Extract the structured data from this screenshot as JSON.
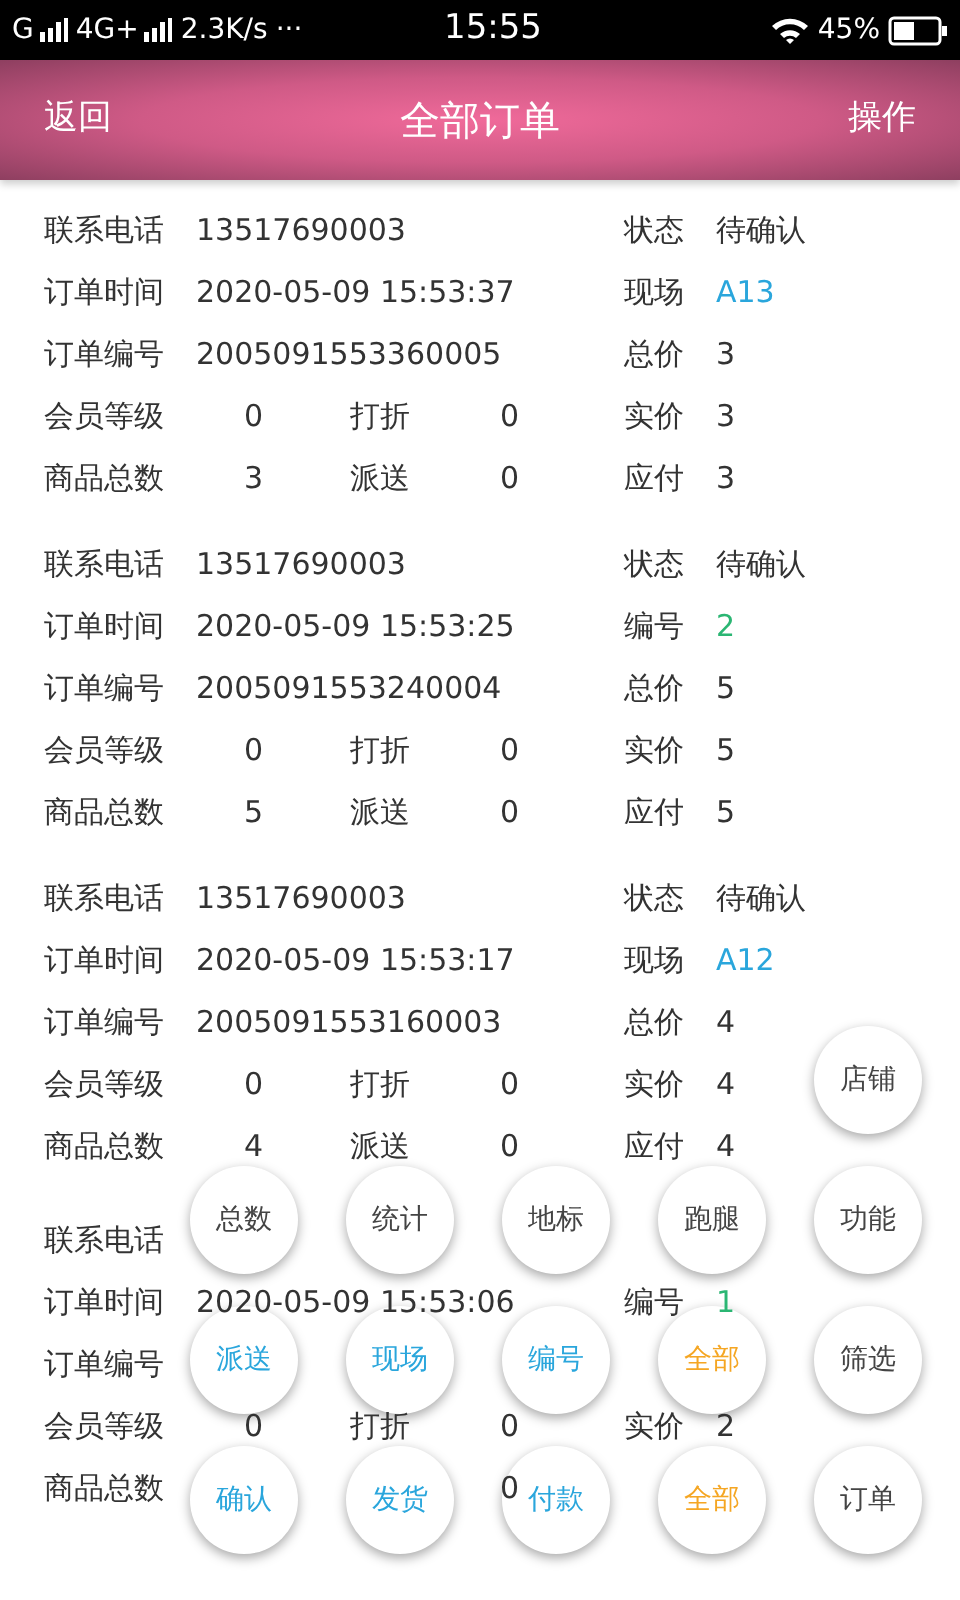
{
  "status_bar": {
    "left": [
      "G",
      "4G+",
      "2.3K/s",
      "···"
    ],
    "time": "15:55",
    "battery": "45%"
  },
  "header": {
    "back": "返回",
    "title": "全部订单",
    "action": "操作"
  },
  "orders": [
    {
      "rows": [
        [
          {
            "text": "联系电话",
            "kind": "label"
          },
          {
            "text": "13517690003",
            "kind": "value"
          },
          null,
          null,
          {
            "text": "状态",
            "kind": "label"
          },
          {
            "text": "待确认",
            "kind": "value"
          }
        ],
        [
          {
            "text": "订单时间",
            "kind": "label"
          },
          {
            "text": "2020-05-09 15:53:37",
            "kind": "value"
          },
          null,
          null,
          {
            "text": "现场",
            "kind": "label"
          },
          {
            "text": "A13",
            "kind": "site"
          }
        ],
        [
          {
            "text": "订单编号",
            "kind": "label"
          },
          {
            "text": "2005091553360005",
            "kind": "value"
          },
          null,
          null,
          {
            "text": "总价",
            "kind": "label"
          },
          {
            "text": "3",
            "kind": "value"
          }
        ],
        [
          {
            "text": "会员等级",
            "kind": "label"
          },
          {
            "text": "0",
            "kind": "value"
          },
          {
            "text": "打折",
            "kind": "label"
          },
          {
            "text": "0",
            "kind": "value"
          },
          {
            "text": "实价",
            "kind": "label"
          },
          {
            "text": "3",
            "kind": "value"
          }
        ],
        [
          {
            "text": "商品总数",
            "kind": "label"
          },
          {
            "text": "3",
            "kind": "value"
          },
          {
            "text": "派送",
            "kind": "label"
          },
          {
            "text": "0",
            "kind": "value"
          },
          {
            "text": "应付",
            "kind": "label"
          },
          {
            "text": "3",
            "kind": "value"
          }
        ]
      ]
    },
    {
      "rows": [
        [
          {
            "text": "联系电话",
            "kind": "label"
          },
          {
            "text": "13517690003",
            "kind": "value"
          },
          null,
          null,
          {
            "text": "状态",
            "kind": "label"
          },
          {
            "text": "待确认",
            "kind": "value"
          }
        ],
        [
          {
            "text": "订单时间",
            "kind": "label"
          },
          {
            "text": "2020-05-09 15:53:25",
            "kind": "value"
          },
          null,
          null,
          {
            "text": "编号",
            "kind": "label"
          },
          {
            "text": "2",
            "kind": "number"
          }
        ],
        [
          {
            "text": "订单编号",
            "kind": "label"
          },
          {
            "text": "2005091553240004",
            "kind": "value"
          },
          null,
          null,
          {
            "text": "总价",
            "kind": "label"
          },
          {
            "text": "5",
            "kind": "value"
          }
        ],
        [
          {
            "text": "会员等级",
            "kind": "label"
          },
          {
            "text": "0",
            "kind": "value"
          },
          {
            "text": "打折",
            "kind": "label"
          },
          {
            "text": "0",
            "kind": "value"
          },
          {
            "text": "实价",
            "kind": "label"
          },
          {
            "text": "5",
            "kind": "value"
          }
        ],
        [
          {
            "text": "商品总数",
            "kind": "label"
          },
          {
            "text": "5",
            "kind": "value"
          },
          {
            "text": "派送",
            "kind": "label"
          },
          {
            "text": "0",
            "kind": "value"
          },
          {
            "text": "应付",
            "kind": "label"
          },
          {
            "text": "5",
            "kind": "value"
          }
        ]
      ]
    },
    {
      "rows": [
        [
          {
            "text": "联系电话",
            "kind": "label"
          },
          {
            "text": "13517690003",
            "kind": "value"
          },
          null,
          null,
          {
            "text": "状态",
            "kind": "label"
          },
          {
            "text": "待确认",
            "kind": "value"
          }
        ],
        [
          {
            "text": "订单时间",
            "kind": "label"
          },
          {
            "text": "2020-05-09 15:53:17",
            "kind": "value"
          },
          null,
          null,
          {
            "text": "现场",
            "kind": "label"
          },
          {
            "text": "A12",
            "kind": "site"
          }
        ],
        [
          {
            "text": "订单编号",
            "kind": "label"
          },
          {
            "text": "2005091553160003",
            "kind": "value"
          },
          null,
          null,
          {
            "text": "总价",
            "kind": "label"
          },
          {
            "text": "4",
            "kind": "value"
          }
        ],
        [
          {
            "text": "会员等级",
            "kind": "label"
          },
          {
            "text": "0",
            "kind": "value"
          },
          {
            "text": "打折",
            "kind": "label"
          },
          {
            "text": "0",
            "kind": "value"
          },
          {
            "text": "实价",
            "kind": "label"
          },
          {
            "text": "4",
            "kind": "value"
          }
        ],
        [
          {
            "text": "商品总数",
            "kind": "label"
          },
          {
            "text": "4",
            "kind": "value"
          },
          {
            "text": "派送",
            "kind": "label"
          },
          {
            "text": "0",
            "kind": "value"
          },
          {
            "text": "应付",
            "kind": "label"
          },
          {
            "text": "4",
            "kind": "value"
          }
        ]
      ]
    },
    {
      "rows": [
        [
          {
            "text": "联系电话",
            "kind": "label"
          },
          null,
          null,
          null,
          null,
          null
        ],
        [
          {
            "text": "订单时间",
            "kind": "label"
          },
          {
            "text": "2020-05-09 15:53:06",
            "kind": "value"
          },
          null,
          null,
          {
            "text": "编号",
            "kind": "label"
          },
          {
            "text": "1",
            "kind": "number"
          }
        ],
        [
          {
            "text": "订单编号",
            "kind": "label"
          },
          null,
          null,
          null,
          null,
          null
        ],
        [
          {
            "text": "会员等级",
            "kind": "label"
          },
          {
            "text": "0",
            "kind": "value"
          },
          {
            "text": "打折",
            "kind": "label"
          },
          {
            "text": "0",
            "kind": "value"
          },
          {
            "text": "实价",
            "kind": "label"
          },
          {
            "text": "2",
            "kind": "value"
          }
        ],
        [
          {
            "text": "商品总数",
            "kind": "label"
          },
          null,
          null,
          {
            "text": "0",
            "kind": "value"
          },
          null,
          null
        ]
      ]
    }
  ],
  "fab_rows": [
    [
      null,
      null,
      null,
      null,
      {
        "label": "店铺",
        "color": "#444444"
      }
    ],
    [
      {
        "label": "总数",
        "color": "#444444"
      },
      {
        "label": "统计",
        "color": "#444444"
      },
      {
        "label": "地标",
        "color": "#444444"
      },
      {
        "label": "跑腿",
        "color": "#444444"
      },
      {
        "label": "功能",
        "color": "#444444"
      }
    ],
    [
      {
        "label": "派送",
        "color": "#2aa6dc"
      },
      {
        "label": "现场",
        "color": "#2aa6dc"
      },
      {
        "label": "编号",
        "color": "#2aa6dc"
      },
      {
        "label": "全部",
        "color": "#f5a623"
      },
      {
        "label": "筛选",
        "color": "#444444"
      }
    ],
    [
      {
        "label": "确认",
        "color": "#2aa6dc"
      },
      {
        "label": "发货",
        "color": "#2aa6dc"
      },
      {
        "label": "付款",
        "color": "#2aa6dc"
      },
      {
        "label": "全部",
        "color": "#f5a623"
      },
      {
        "label": "订单",
        "color": "#444444"
      }
    ]
  ]
}
